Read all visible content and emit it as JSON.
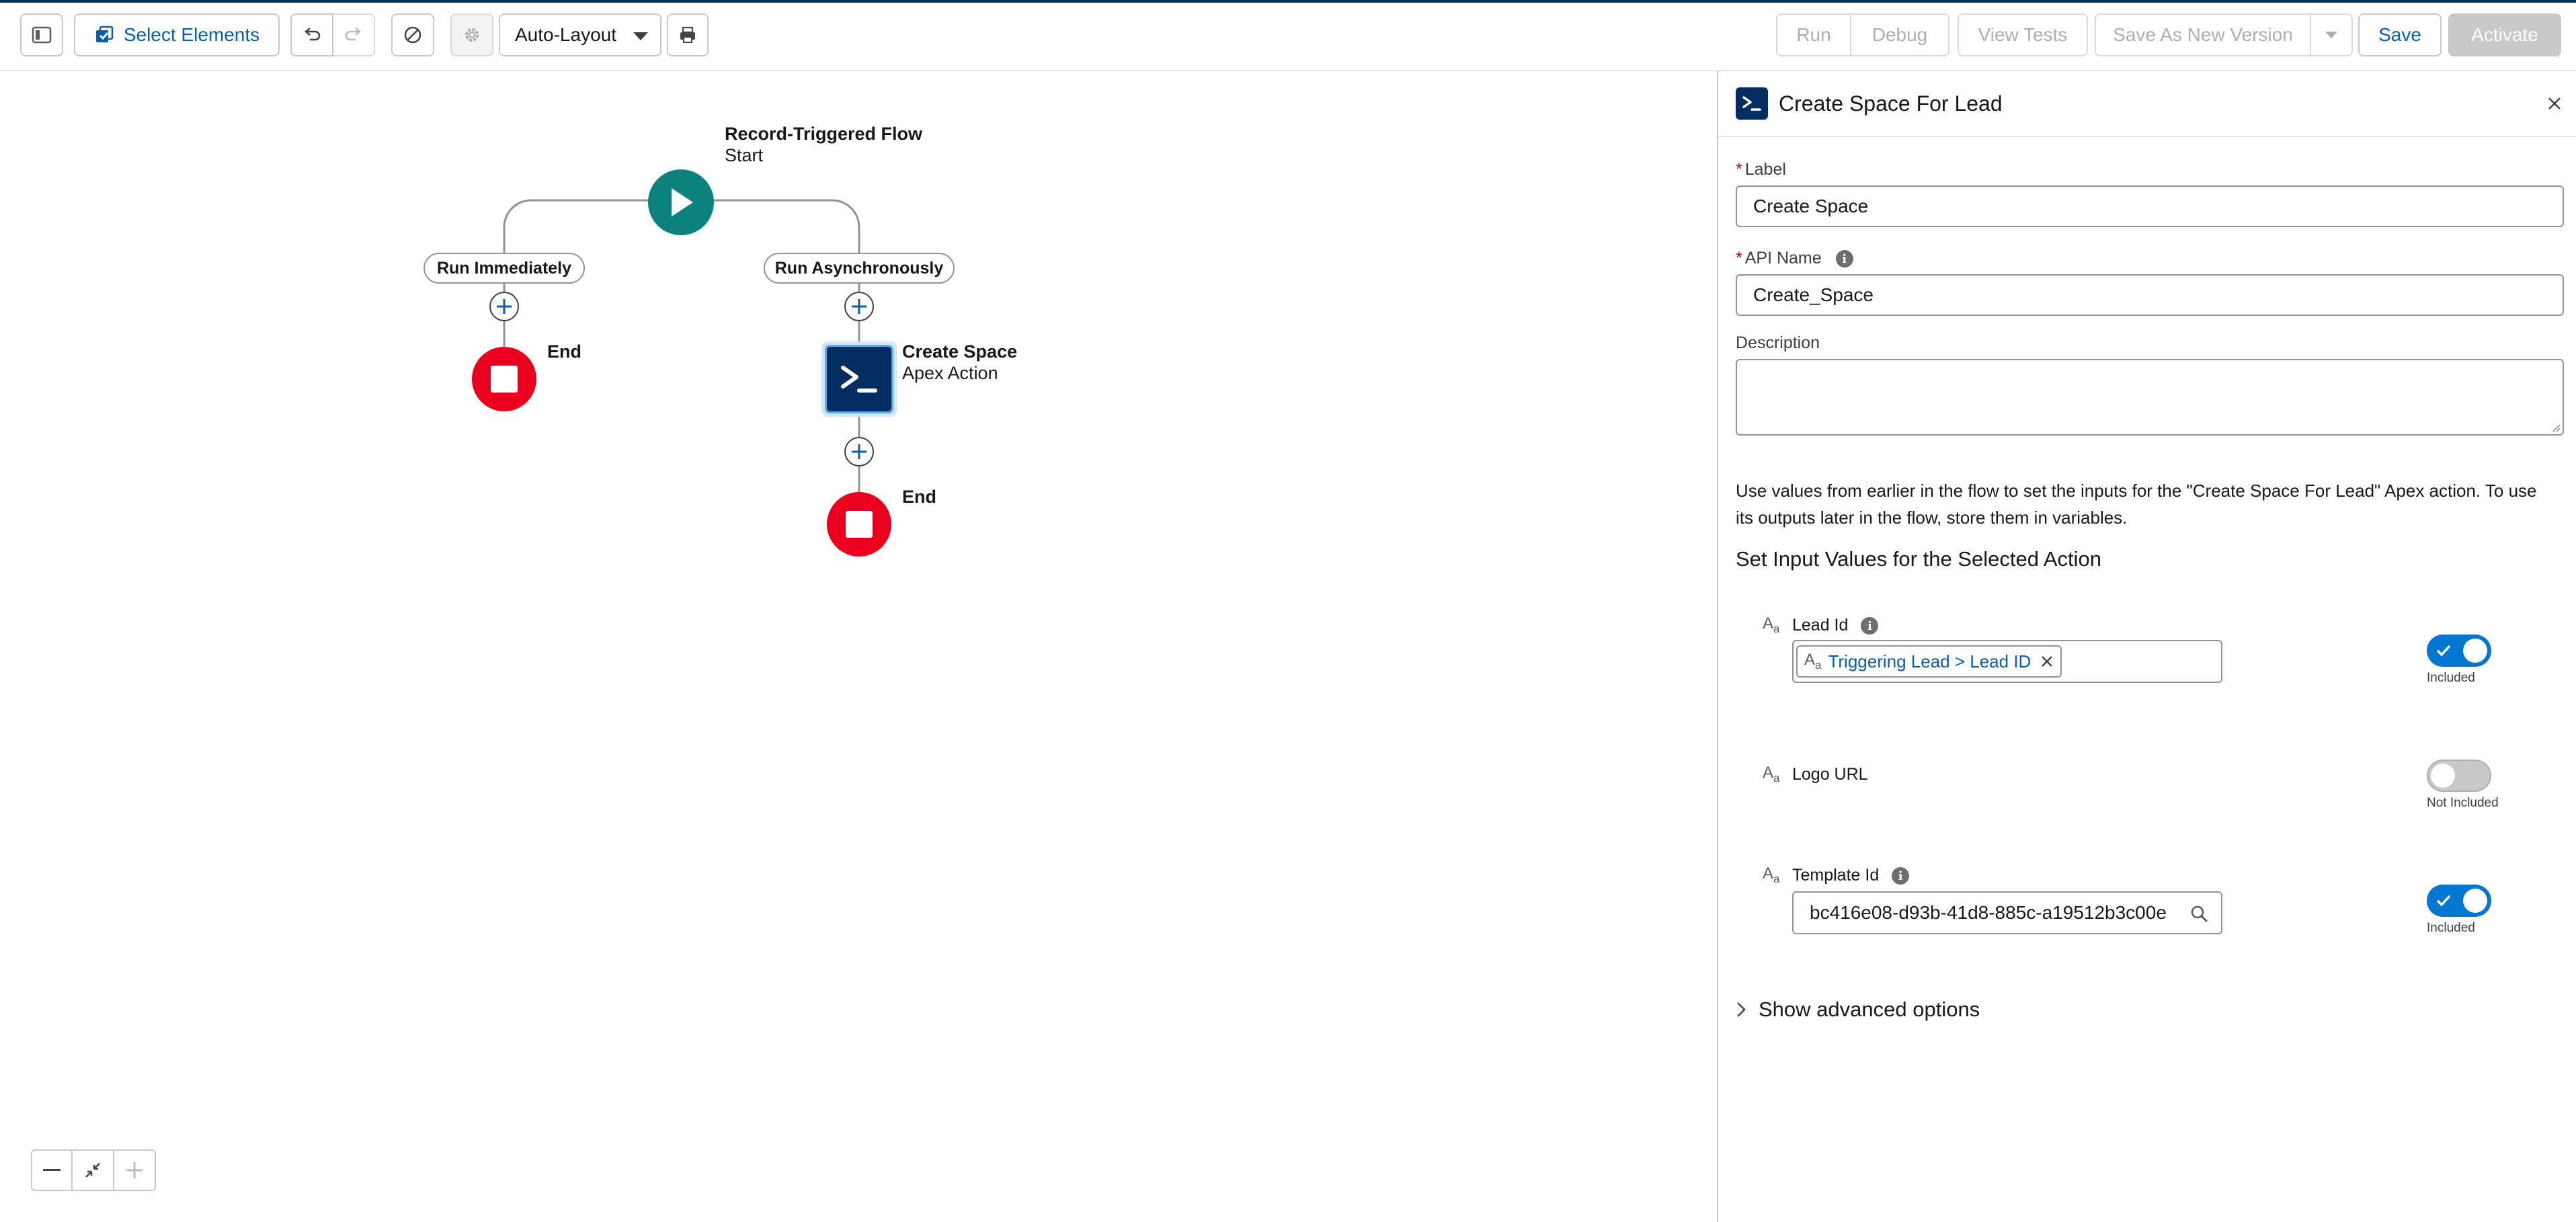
{
  "toolbar": {
    "select_elements_label": "Select Elements",
    "layout_select_value": "Auto-Layout",
    "run_label": "Run",
    "debug_label": "Debug",
    "view_tests_label": "View Tests",
    "save_as_new_version_label": "Save As New Version",
    "save_label": "Save",
    "activate_label": "Activate",
    "icons": [
      "panel-toggle-icon",
      "select-elements-icon",
      "undo-icon",
      "redo-icon",
      "no-entry-icon",
      "gear-icon",
      "chevron-down-icon",
      "print-icon"
    ]
  },
  "canvas": {
    "start": {
      "title": "Record-Triggered Flow",
      "subtitle": "Start"
    },
    "branches": [
      {
        "label": "Run Immediately"
      },
      {
        "label": "Run Asynchronously"
      }
    ],
    "end_label": "End",
    "action_node": {
      "title": "Create Space",
      "subtitle": "Apex Action"
    },
    "zoom_controls": [
      "zoom-out-icon",
      "fit-view-icon",
      "zoom-in-icon"
    ]
  },
  "panel": {
    "header_title": "Create Space For Lead",
    "label_field": {
      "label": "Label",
      "value": "Create Space"
    },
    "api_name_field": {
      "label": "API Name",
      "value": "Create_Space"
    },
    "description_field": {
      "label": "Description",
      "value": ""
    },
    "help_text": "Use values from earlier in the flow to set the inputs for the \"Create Space For Lead\" Apex action. To use its outputs later in the flow, store them in variables.",
    "section_heading": "Set Input Values for the Selected Action",
    "inputs": [
      {
        "name": "Lead Id",
        "token": "Triggering Lead > Lead ID",
        "toggle_caption": "Included",
        "included": true
      },
      {
        "name": "Logo URL",
        "toggle_caption": "Not Included",
        "included": false
      },
      {
        "name": "Template Id",
        "value": "bc416e08-d93b-41d8-885c-a19512b3c00e",
        "toggle_caption": "Included",
        "included": true
      }
    ],
    "advanced_options_label": "Show advanced options"
  },
  "colors": {
    "brand_blue": "#0176d3",
    "start_teal": "#0b827c",
    "end_red": "#ea001e",
    "apex_navy": "#032d60"
  }
}
